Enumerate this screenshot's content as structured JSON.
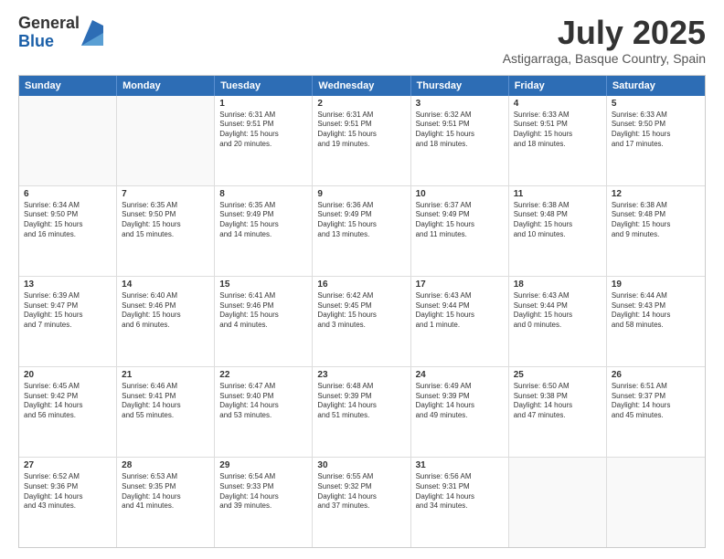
{
  "header": {
    "logo_general": "General",
    "logo_blue": "Blue",
    "month_title": "July 2025",
    "location": "Astigarraga, Basque Country, Spain"
  },
  "days_of_week": [
    "Sunday",
    "Monday",
    "Tuesday",
    "Wednesday",
    "Thursday",
    "Friday",
    "Saturday"
  ],
  "weeks": [
    [
      {
        "day": "",
        "info": ""
      },
      {
        "day": "",
        "info": ""
      },
      {
        "day": "1",
        "info": "Sunrise: 6:31 AM\nSunset: 9:51 PM\nDaylight: 15 hours\nand 20 minutes."
      },
      {
        "day": "2",
        "info": "Sunrise: 6:31 AM\nSunset: 9:51 PM\nDaylight: 15 hours\nand 19 minutes."
      },
      {
        "day": "3",
        "info": "Sunrise: 6:32 AM\nSunset: 9:51 PM\nDaylight: 15 hours\nand 18 minutes."
      },
      {
        "day": "4",
        "info": "Sunrise: 6:33 AM\nSunset: 9:51 PM\nDaylight: 15 hours\nand 18 minutes."
      },
      {
        "day": "5",
        "info": "Sunrise: 6:33 AM\nSunset: 9:50 PM\nDaylight: 15 hours\nand 17 minutes."
      }
    ],
    [
      {
        "day": "6",
        "info": "Sunrise: 6:34 AM\nSunset: 9:50 PM\nDaylight: 15 hours\nand 16 minutes."
      },
      {
        "day": "7",
        "info": "Sunrise: 6:35 AM\nSunset: 9:50 PM\nDaylight: 15 hours\nand 15 minutes."
      },
      {
        "day": "8",
        "info": "Sunrise: 6:35 AM\nSunset: 9:49 PM\nDaylight: 15 hours\nand 14 minutes."
      },
      {
        "day": "9",
        "info": "Sunrise: 6:36 AM\nSunset: 9:49 PM\nDaylight: 15 hours\nand 13 minutes."
      },
      {
        "day": "10",
        "info": "Sunrise: 6:37 AM\nSunset: 9:49 PM\nDaylight: 15 hours\nand 11 minutes."
      },
      {
        "day": "11",
        "info": "Sunrise: 6:38 AM\nSunset: 9:48 PM\nDaylight: 15 hours\nand 10 minutes."
      },
      {
        "day": "12",
        "info": "Sunrise: 6:38 AM\nSunset: 9:48 PM\nDaylight: 15 hours\nand 9 minutes."
      }
    ],
    [
      {
        "day": "13",
        "info": "Sunrise: 6:39 AM\nSunset: 9:47 PM\nDaylight: 15 hours\nand 7 minutes."
      },
      {
        "day": "14",
        "info": "Sunrise: 6:40 AM\nSunset: 9:46 PM\nDaylight: 15 hours\nand 6 minutes."
      },
      {
        "day": "15",
        "info": "Sunrise: 6:41 AM\nSunset: 9:46 PM\nDaylight: 15 hours\nand 4 minutes."
      },
      {
        "day": "16",
        "info": "Sunrise: 6:42 AM\nSunset: 9:45 PM\nDaylight: 15 hours\nand 3 minutes."
      },
      {
        "day": "17",
        "info": "Sunrise: 6:43 AM\nSunset: 9:44 PM\nDaylight: 15 hours\nand 1 minute."
      },
      {
        "day": "18",
        "info": "Sunrise: 6:43 AM\nSunset: 9:44 PM\nDaylight: 15 hours\nand 0 minutes."
      },
      {
        "day": "19",
        "info": "Sunrise: 6:44 AM\nSunset: 9:43 PM\nDaylight: 14 hours\nand 58 minutes."
      }
    ],
    [
      {
        "day": "20",
        "info": "Sunrise: 6:45 AM\nSunset: 9:42 PM\nDaylight: 14 hours\nand 56 minutes."
      },
      {
        "day": "21",
        "info": "Sunrise: 6:46 AM\nSunset: 9:41 PM\nDaylight: 14 hours\nand 55 minutes."
      },
      {
        "day": "22",
        "info": "Sunrise: 6:47 AM\nSunset: 9:40 PM\nDaylight: 14 hours\nand 53 minutes."
      },
      {
        "day": "23",
        "info": "Sunrise: 6:48 AM\nSunset: 9:39 PM\nDaylight: 14 hours\nand 51 minutes."
      },
      {
        "day": "24",
        "info": "Sunrise: 6:49 AM\nSunset: 9:39 PM\nDaylight: 14 hours\nand 49 minutes."
      },
      {
        "day": "25",
        "info": "Sunrise: 6:50 AM\nSunset: 9:38 PM\nDaylight: 14 hours\nand 47 minutes."
      },
      {
        "day": "26",
        "info": "Sunrise: 6:51 AM\nSunset: 9:37 PM\nDaylight: 14 hours\nand 45 minutes."
      }
    ],
    [
      {
        "day": "27",
        "info": "Sunrise: 6:52 AM\nSunset: 9:36 PM\nDaylight: 14 hours\nand 43 minutes."
      },
      {
        "day": "28",
        "info": "Sunrise: 6:53 AM\nSunset: 9:35 PM\nDaylight: 14 hours\nand 41 minutes."
      },
      {
        "day": "29",
        "info": "Sunrise: 6:54 AM\nSunset: 9:33 PM\nDaylight: 14 hours\nand 39 minutes."
      },
      {
        "day": "30",
        "info": "Sunrise: 6:55 AM\nSunset: 9:32 PM\nDaylight: 14 hours\nand 37 minutes."
      },
      {
        "day": "31",
        "info": "Sunrise: 6:56 AM\nSunset: 9:31 PM\nDaylight: 14 hours\nand 34 minutes."
      },
      {
        "day": "",
        "info": ""
      },
      {
        "day": "",
        "info": ""
      }
    ]
  ]
}
